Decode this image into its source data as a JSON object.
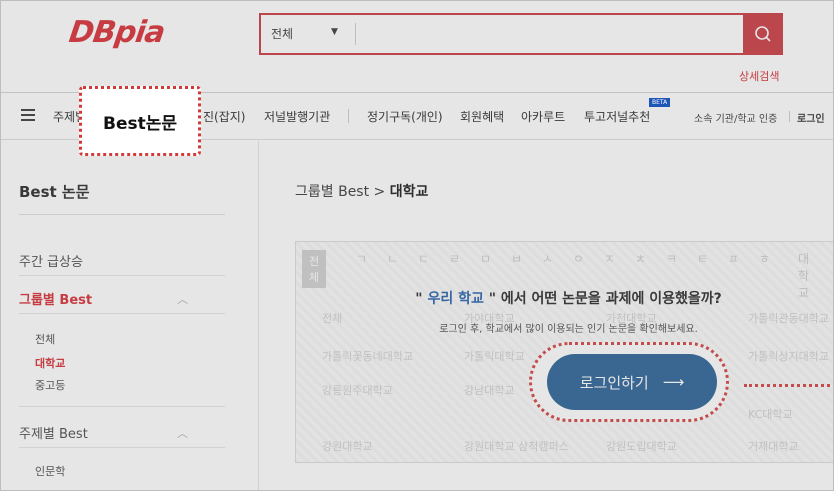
{
  "header": {
    "logo_text": "DBpia",
    "search_scope": "전체",
    "search_placeholder": "",
    "advanced_search": "상세검색"
  },
  "nav": {
    "items": [
      "주제별",
      "진(잡지)",
      "저널발행기관",
      "정기구독(개인)",
      "회원혜택",
      "아카루트",
      "투고저널추천"
    ],
    "beta_badge": "BETA",
    "institution_auth": "소속 기관/학교 인증",
    "login": "로그인"
  },
  "callout": {
    "label": "Best논문"
  },
  "sidebar": {
    "title": "Best 논문",
    "weekly": "주간 급상승",
    "group_best": "그룹별 Best",
    "group_sub": [
      "전체",
      "대학교",
      "중고등"
    ],
    "topic_best": "주제별 Best",
    "topic_sub": [
      "인문학"
    ]
  },
  "main": {
    "breadcrumb_prefix": "그룹별 Best >",
    "breadcrumb_current": "대학교",
    "consonants": [
      "전체",
      "ㄱ",
      "ㄴ",
      "ㄷ",
      "ㄹ",
      "ㅁ",
      "ㅂ",
      "ㅅ",
      "ㅇ",
      "ㅈ",
      "ㅊ",
      "ㅋ",
      "ㅌ",
      "ㅍ",
      "ㅎ",
      "대학교"
    ],
    "ghost_rows": [
      [
        "전체",
        "가야대학교",
        "가천대학교",
        "가톨릭관동대학교"
      ],
      [
        "가톨릭꽃동네대학교",
        "가톨릭대학교",
        "가톨릭상지대학교"
      ],
      [
        "강릉원주대학교",
        "강남대학교",
        "KC대학교"
      ],
      [
        "강원대학교",
        "강원대학교 삼척캠퍼스",
        "강원도립대학교",
        "거제대학교"
      ]
    ],
    "prompt_open": "\"",
    "prompt_school": "우리 학교",
    "prompt_rest": "\" 에서 어떤 논문을 과제에 이용했을까?",
    "prompt_sub": "로그인 후, 학교에서 많이 이용되는 인기 논문을 확인해보세요.",
    "login_button": "로그인하기",
    "login_arrow": "⟶"
  },
  "colors": {
    "brand_red": "#d8262d",
    "button_blue": "#235d93",
    "highlight_dotted": "#d23a3a"
  }
}
